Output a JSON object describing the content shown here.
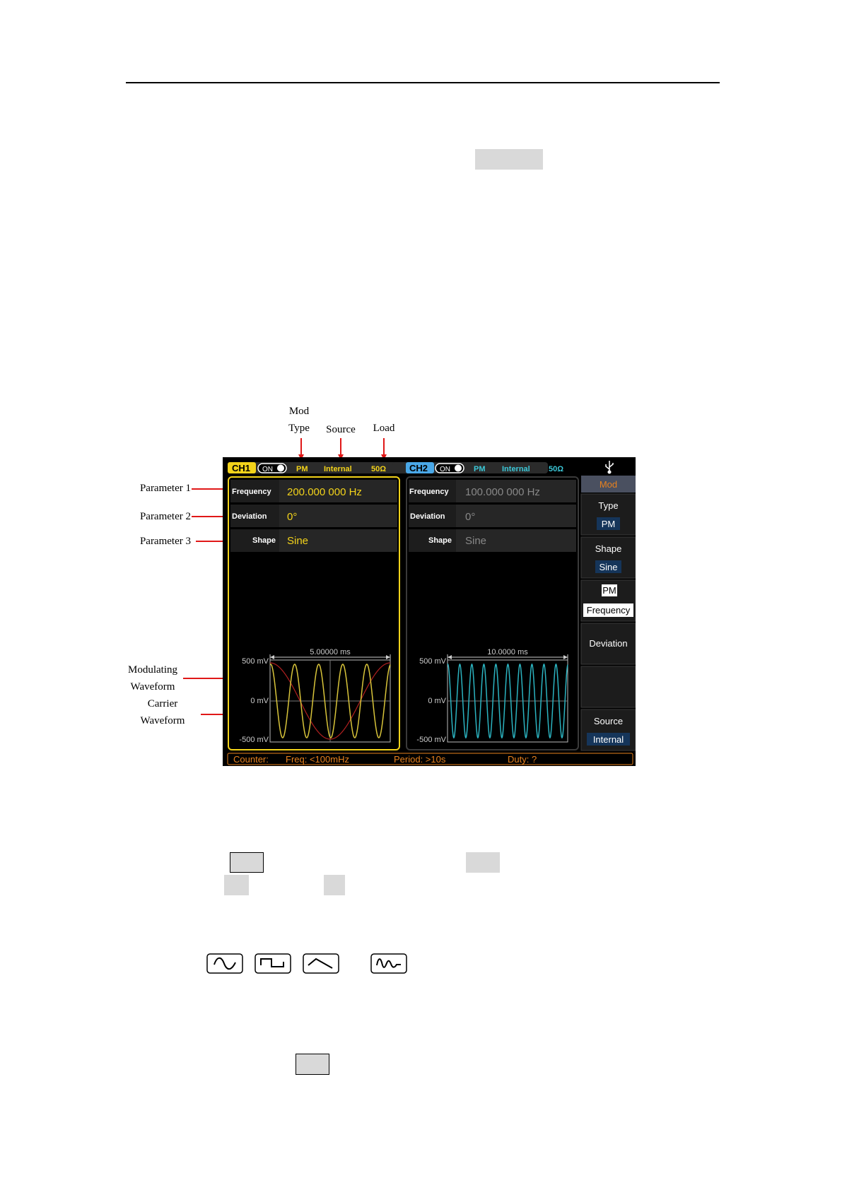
{
  "annotations": {
    "mod_line1": "Mod",
    "mod_line2": "Type",
    "source": "Source",
    "load": "Load",
    "parameter1": "Parameter 1",
    "parameter2": "Parameter 2",
    "parameter3": "Parameter 3",
    "modulating_line1": "Modulating",
    "modulating_line2": "Waveform",
    "carrier_line1": "Carrier",
    "carrier_line2": "Waveform"
  },
  "ch1": {
    "label": "CH1",
    "on": "ON",
    "mod": "PM",
    "source": "Internal",
    "load": "50Ω",
    "params": [
      {
        "name": "Frequency",
        "value": "200.000 000 Hz"
      },
      {
        "name": "Deviation",
        "value": "0°"
      },
      {
        "name": "Shape",
        "value": "Sine"
      }
    ],
    "time": "5.00000 ms",
    "y_top": "500 mV",
    "y_mid": "0 mV",
    "y_bot": "-500 mV"
  },
  "ch2": {
    "label": "CH2",
    "on": "ON",
    "mod": "PM",
    "source": "Internal",
    "load": "50Ω",
    "params": [
      {
        "name": "Frequency",
        "value": "100.000 000 Hz"
      },
      {
        "name": "Deviation",
        "value": "0°"
      },
      {
        "name": "Shape",
        "value": "Sine"
      }
    ],
    "time": "10.0000 ms",
    "y_top": "500 mV",
    "y_mid": "0 mV",
    "y_bot": "-500 mV"
  },
  "menu": {
    "title": "Mod",
    "type_label": "Type",
    "type_value": "PM",
    "shape_label": "Shape",
    "shape_value": "Sine",
    "pm_label": "PM",
    "frequency_label": "Frequency",
    "deviation_label": "Deviation",
    "source_label": "Source",
    "source_value": "Internal"
  },
  "counter": {
    "label": "Counter:",
    "freq": "Freq: <100mHz",
    "period": "Period: >10s",
    "duty": "Duty: ?"
  },
  "colors": {
    "ch1": "#f3d31a",
    "ch2": "#4aa8e8",
    "accent": "#e8821e",
    "carrier": "#d8c43a",
    "modulating": "#b22020",
    "ch2_wave": "#2bb3c0"
  }
}
